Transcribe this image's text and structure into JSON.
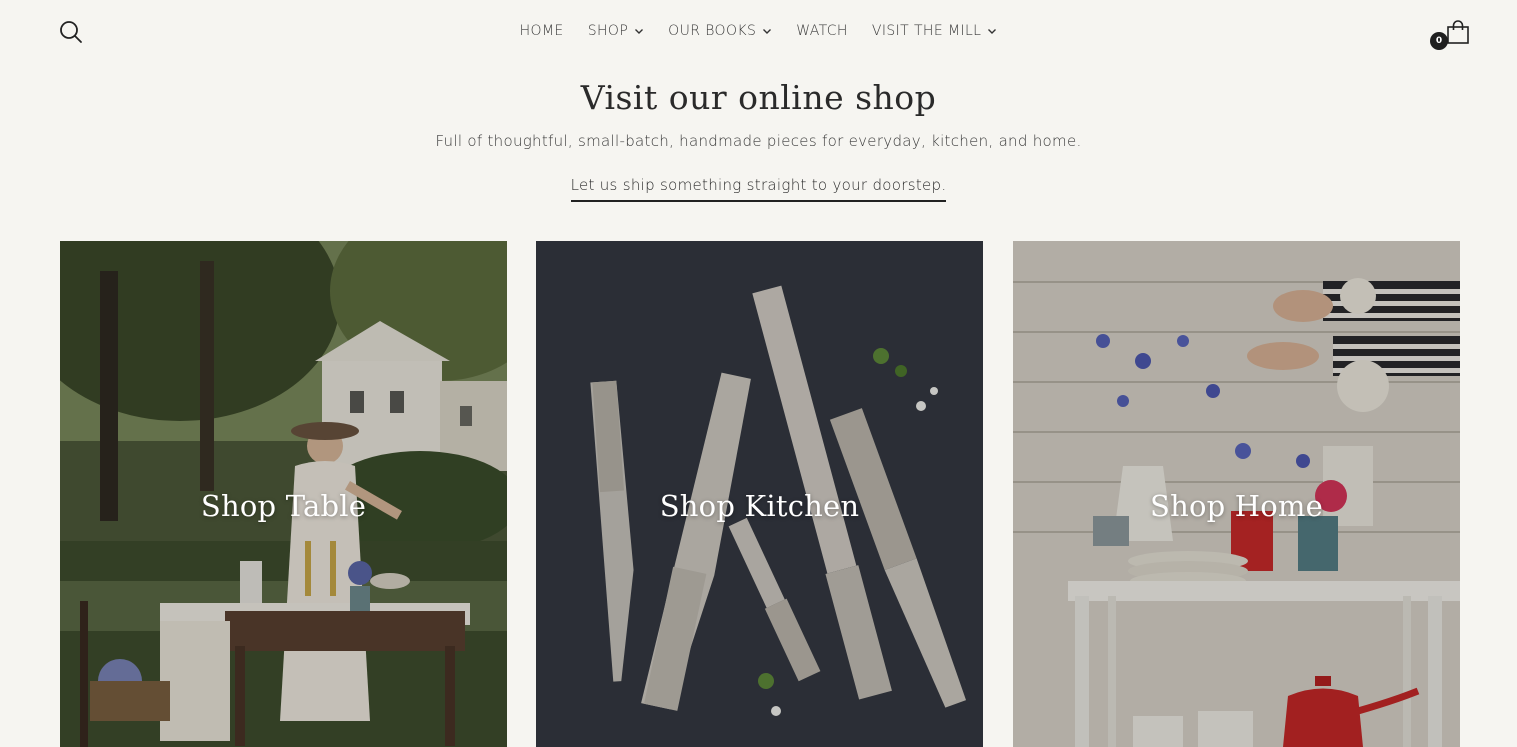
{
  "nav": {
    "items": [
      {
        "label": "HOME",
        "has_dropdown": false
      },
      {
        "label": "SHOP",
        "has_dropdown": true
      },
      {
        "label": "OUR BOOKS",
        "has_dropdown": true
      },
      {
        "label": "WATCH",
        "has_dropdown": false
      },
      {
        "label": "VISIT THE MILL",
        "has_dropdown": true
      }
    ],
    "search_icon": "search-icon",
    "cart_icon": "shopping-bag-icon",
    "cart_count": "0"
  },
  "intro": {
    "title": "Visit our online shop",
    "subtitle": "Full of thoughtful, small-batch, handmade pieces for everyday, kitchen, and home.",
    "link": "Let us ship something straight to your doorstep."
  },
  "tiles": [
    {
      "label": "Shop Table"
    },
    {
      "label": "Shop Kitchen"
    },
    {
      "label": "Shop Home"
    }
  ],
  "colors": {
    "background": "#f6f5f1",
    "text": "#2b2b2b",
    "tile_label": "#ffffff",
    "cart_badge": "#1f1f1f"
  }
}
